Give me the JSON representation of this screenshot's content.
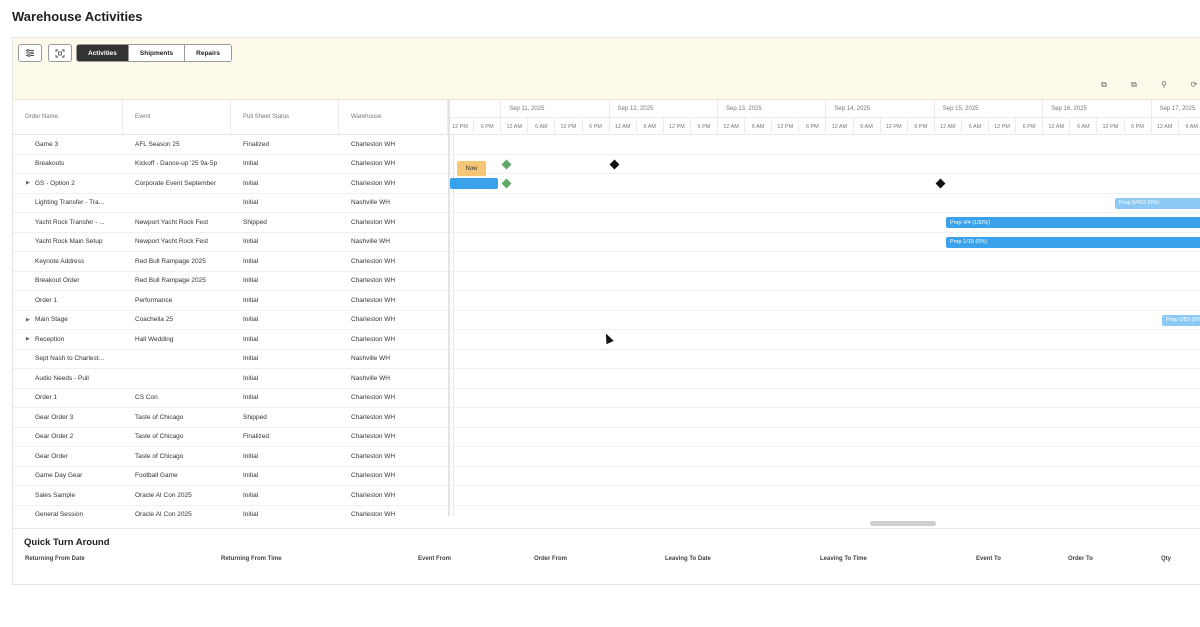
{
  "page": {
    "title": "Warehouse Activities"
  },
  "toolbar": {
    "tabs": [
      {
        "label": "Activities",
        "active": true
      },
      {
        "label": "Shipments",
        "active": false
      },
      {
        "label": "Repairs",
        "active": false
      }
    ],
    "left_icons": [
      "filter-icon",
      "fit-view-icon"
    ],
    "right_icons": [
      "copy-icon",
      "duplicate-icon",
      "zoom-icon",
      "refresh-icon"
    ]
  },
  "grid": {
    "columns": [
      "Order Name",
      "Event",
      "Pull Sheet Status",
      "Warehouse"
    ],
    "rows": [
      {
        "name": "Game 3",
        "event": "AFL Season 25",
        "status": "Finalized",
        "warehouse": "Charleston WH",
        "expandable": false
      },
      {
        "name": "Breakouts",
        "event": "Kickoff - Dance-up '25 9a-5p",
        "status": "Initial",
        "warehouse": "Charleston WH",
        "expandable": false
      },
      {
        "name": "GS - Option 2",
        "event": "Corporate Event September",
        "status": "Initial",
        "warehouse": "Charleston WH",
        "expandable": true
      },
      {
        "name": "Lighting Transfer - Tra...",
        "event": "",
        "status": "Initial",
        "warehouse": "Nashville WH",
        "expandable": false
      },
      {
        "name": "Yacht Rock Transfer - ...",
        "event": "Newport Yacht Rock Fest",
        "status": "Shipped",
        "warehouse": "Charleston WH",
        "expandable": false
      },
      {
        "name": "Yacht Rock Main Setup",
        "event": "Newport Yacht Rock Fest",
        "status": "Initial",
        "warehouse": "Nashville WH",
        "expandable": false
      },
      {
        "name": "Keynote Address",
        "event": "Red Bull Rampage 2025",
        "status": "Initial",
        "warehouse": "Charleston WH",
        "expandable": false
      },
      {
        "name": "Breakout Order",
        "event": "Red Bull Rampage 2025",
        "status": "Initial",
        "warehouse": "Charleston WH",
        "expandable": false
      },
      {
        "name": "Order 1",
        "event": "Performance",
        "status": "Initial",
        "warehouse": "Charleston WH",
        "expandable": false
      },
      {
        "name": "Main Stage",
        "event": "Coachella 25",
        "status": "Initial",
        "warehouse": "Charleston WH",
        "expandable": true
      },
      {
        "name": "Reception",
        "event": "Hall Wedding",
        "status": "Initial",
        "warehouse": "Charleston WH",
        "expandable": true
      },
      {
        "name": "Sept Nash to Charlest...",
        "event": "",
        "status": "Initial",
        "warehouse": "Nashville WH",
        "expandable": false
      },
      {
        "name": "Audio Needs - Pull",
        "event": "",
        "status": "Initial",
        "warehouse": "Nashville WH",
        "expandable": false
      },
      {
        "name": "Order 1",
        "event": "CS Con",
        "status": "Initial",
        "warehouse": "Charleston WH",
        "expandable": false
      },
      {
        "name": "Gear Order 3",
        "event": "Taste of Chicago",
        "status": "Shipped",
        "warehouse": "Charleston WH",
        "expandable": false
      },
      {
        "name": "Gear Order 2",
        "event": "Taste of Chicago",
        "status": "Finalized",
        "warehouse": "Charleston WH",
        "expandable": false
      },
      {
        "name": "Gear Order",
        "event": "Taste of Chicago",
        "status": "Initial",
        "warehouse": "Charleston WH",
        "expandable": false
      },
      {
        "name": "Game Day Gear",
        "event": "Football Game",
        "status": "Initial",
        "warehouse": "Charleston WH",
        "expandable": false
      },
      {
        "name": "Sales Sample",
        "event": "Oracle AI Con 2025",
        "status": "Initial",
        "warehouse": "Charleston WH",
        "expandable": false
      },
      {
        "name": "General Session",
        "event": "Oracle AI Con 2025",
        "status": "Initial",
        "warehouse": "Charleston WH",
        "expandable": false
      }
    ]
  },
  "timeline": {
    "days": [
      "Sep 11, 2025",
      "Sep 12, 2025",
      "Sep 13, 2025",
      "Sep 14, 2025",
      "Sep 15, 2025",
      "Sep 16, 2025",
      "Sep 17, 2025"
    ],
    "hours": [
      "12 PM",
      "6 PM",
      "12 AM",
      "6 AM",
      "12 PM",
      "6 PM",
      "12 AM",
      "6 AM",
      "12 PM",
      "6 PM",
      "12 AM",
      "6 AM",
      "12 PM",
      "6 PM",
      "12 AM",
      "6 AM",
      "12 PM",
      "6 PM",
      "12 AM",
      "6 AM",
      "12 PM",
      "6 PM",
      "12 AM",
      "6 AM",
      "12 PM",
      "6 PM",
      "12 AM",
      "6 AM"
    ],
    "now_label": "Now",
    "bar_labels": {
      "lighting": "Prep 0/423 (0%)",
      "yacht_transfer": "Prep 4/4 (100%)",
      "yacht_main": "Prep 1/19 (0%)",
      "main_stage": "Prep 0/83 (0%)"
    },
    "colors": {
      "bar_dark": "#3aa2ea",
      "bar_light": "#8ccaf5",
      "milestone_green": "#5fa86a",
      "milestone_black": "#111111",
      "now": "#f5c677"
    }
  },
  "quick_turn": {
    "title": "Quick Turn Around",
    "columns": [
      "Returning From Date",
      "Returning From Time",
      "Event From",
      "Order From",
      "Leaving To Date",
      "Leaving To Time",
      "Event To",
      "Order To",
      "Qty"
    ]
  }
}
